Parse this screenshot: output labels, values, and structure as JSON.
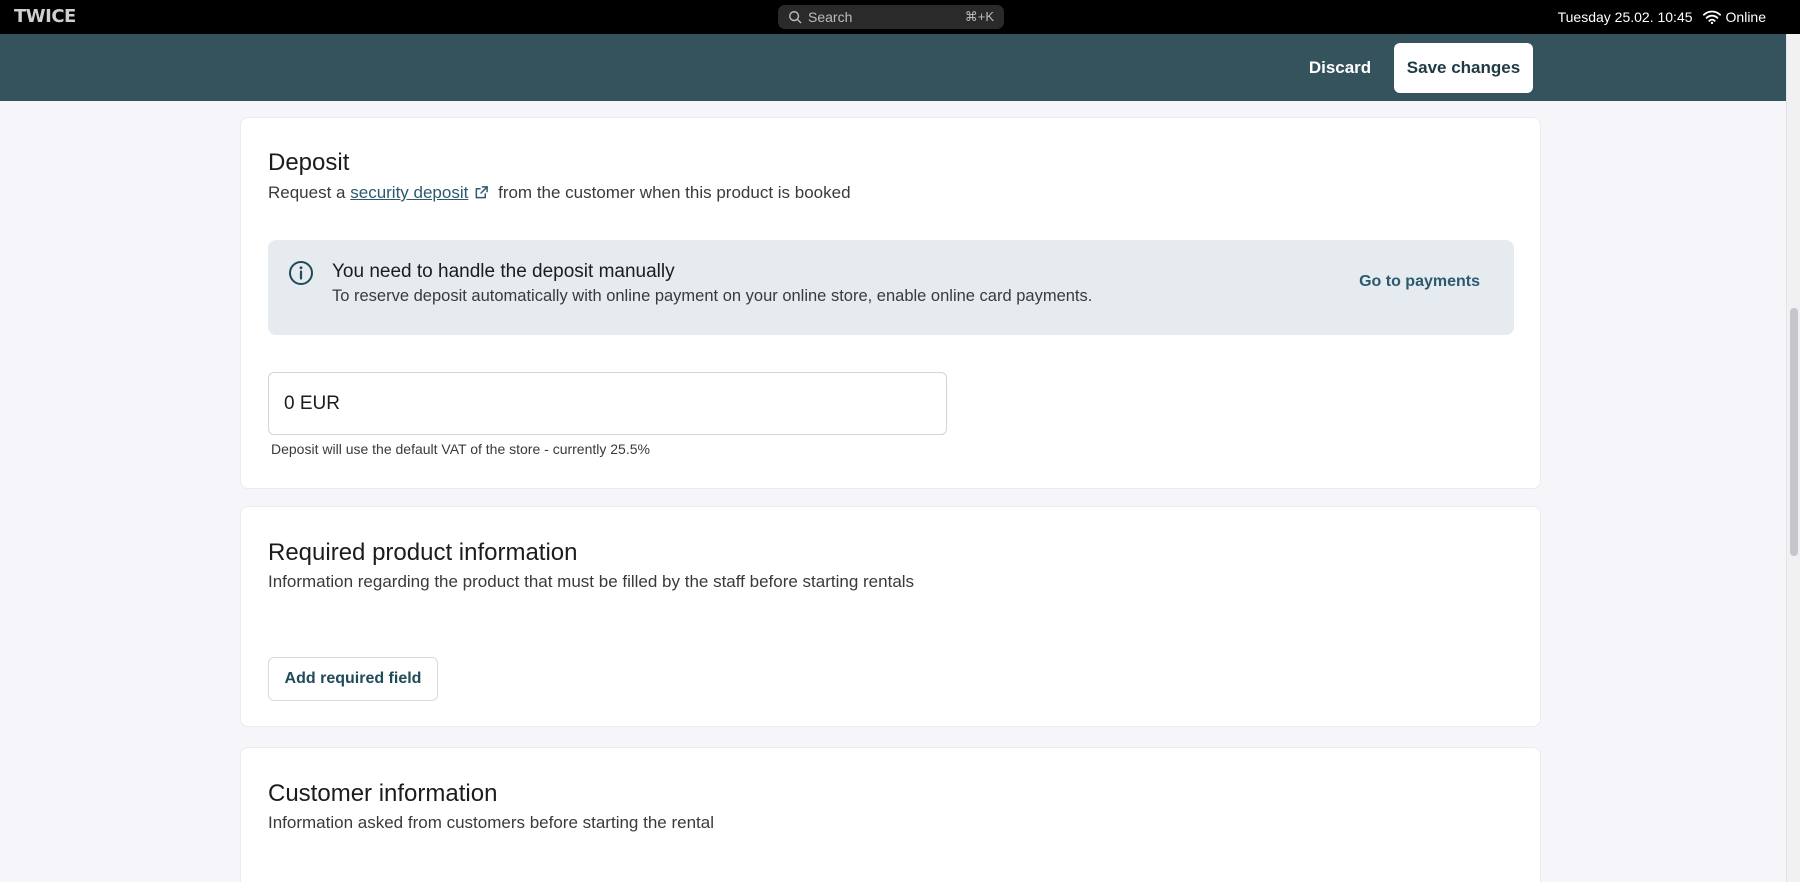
{
  "system_bar": {
    "logo": "TWICE",
    "search_placeholder": "Search",
    "search_shortcut": "⌘+K",
    "datetime": "Tuesday 25.02. 10:45",
    "network_status": "Online"
  },
  "header": {
    "discard_label": "Discard",
    "save_label": "Save changes"
  },
  "deposit": {
    "title": "Deposit",
    "desc_prefix": "Request a",
    "desc_link": "security deposit",
    "desc_suffix": "from the customer when this product is booked",
    "notice_title": "You need to handle the deposit manually",
    "notice_text": "To reserve deposit automatically with online payment on your online store, enable online card payments.",
    "notice_link": "Go to payments",
    "amount_value": "0 EUR",
    "helper": "Deposit will use the default VAT of the store - currently 25.5%"
  },
  "required_info": {
    "title": "Required product information",
    "desc": "Information regarding the product that must be filled by the staff before starting rentals",
    "add_button": "Add required field"
  },
  "customer_info": {
    "title": "Customer information",
    "desc": "Information asked from customers before starting the rental"
  },
  "icons": {
    "search": "search-icon",
    "wifi": "wifi-icon",
    "external_link": "external-link-icon",
    "info": "info-icon"
  },
  "colors": {
    "header_bg": "#34535d",
    "notice_bg": "#e6ebf0",
    "link": "#2b5a6e"
  }
}
